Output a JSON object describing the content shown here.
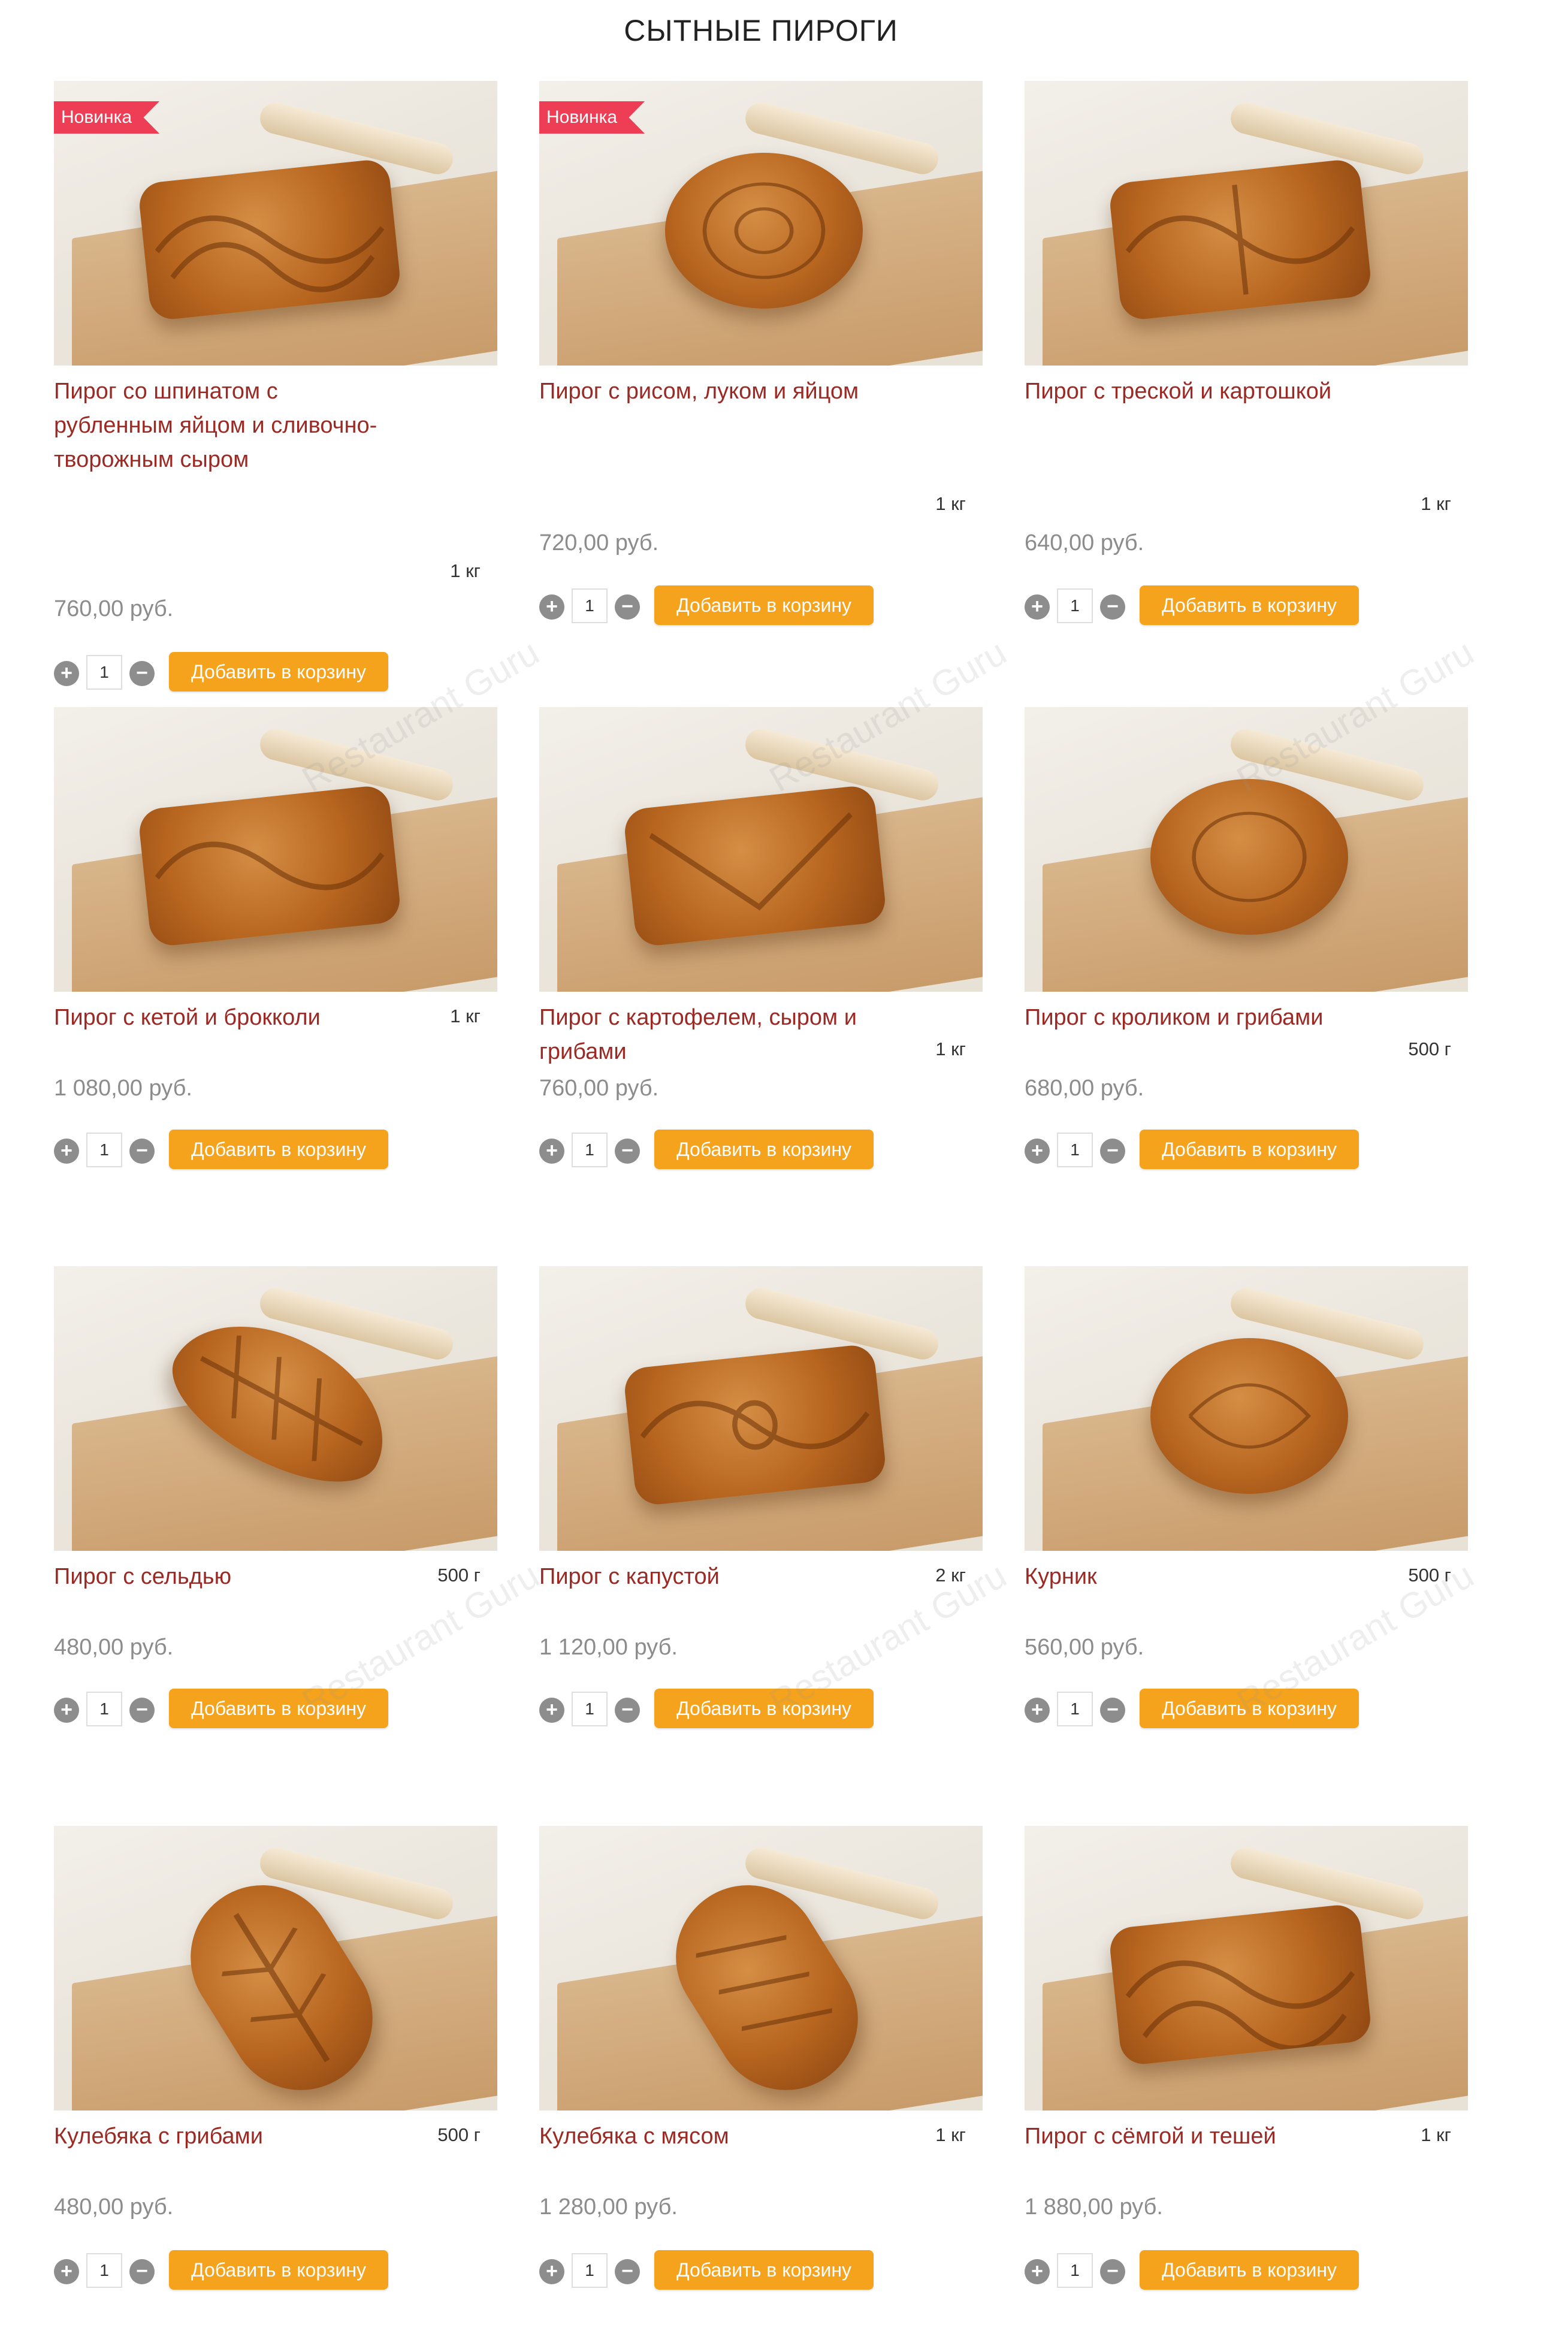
{
  "page": {
    "title": "СЫТНЫЕ ПИРОГИ"
  },
  "accent": {
    "name_color": "#9b2a24",
    "button_color": "#f5a21c",
    "badge_color": "#ee3e55",
    "price_color": "#8c8c8c"
  },
  "watermark": "Restaurant Guru",
  "products": [
    {
      "name": "Пирог со шпинатом с рубленным яйцом и сливочно-творожным сыром",
      "weight": "1 кг",
      "price": "760,00 руб.",
      "badge": "Новинка",
      "qty": "1",
      "add_label": "Добавить в корзину",
      "photo_icon": "pie-photo"
    },
    {
      "name": "Пирог с рисом, луком и яйцом",
      "weight": "1 кг",
      "price": "720,00 руб.",
      "badge": "Новинка",
      "qty": "1",
      "add_label": "Добавить в корзину",
      "photo_icon": "pie-photo"
    },
    {
      "name": "Пирог с треской и картошкой",
      "weight": "1 кг",
      "price": "640,00 руб.",
      "qty": "1",
      "add_label": "Добавить в корзину",
      "photo_icon": "pie-photo"
    },
    {
      "name": "Пирог с кетой и брокколи",
      "weight": "1 кг",
      "price": "1 080,00 руб.",
      "qty": "1",
      "add_label": "Добавить в корзину",
      "photo_icon": "pie-photo"
    },
    {
      "name": "Пирог с картофелем, сыром и грибами",
      "weight": "1 кг",
      "price": "760,00 руб.",
      "qty": "1",
      "add_label": "Добавить в корзину",
      "photo_icon": "pie-photo"
    },
    {
      "name": "Пирог с кроликом и грибами",
      "weight": "500 г",
      "price": "680,00 руб.",
      "qty": "1",
      "add_label": "Добавить в корзину",
      "photo_icon": "pie-photo"
    },
    {
      "name": "Пирог с сельдью",
      "weight": "500 г",
      "price": "480,00 руб.",
      "qty": "1",
      "add_label": "Добавить в корзину",
      "photo_icon": "pie-photo"
    },
    {
      "name": "Пирог с капустой",
      "weight": "2 кг",
      "price": "1 120,00 руб.",
      "qty": "1",
      "add_label": "Добавить в корзину",
      "photo_icon": "pie-photo"
    },
    {
      "name": "Курник",
      "weight": "500 г",
      "price": "560,00 руб.",
      "qty": "1",
      "add_label": "Добавить в корзину",
      "photo_icon": "pie-photo"
    },
    {
      "name": "Кулебяка с грибами",
      "weight": "500 г",
      "price": "480,00 руб.",
      "qty": "1",
      "add_label": "Добавить в корзину",
      "photo_icon": "pie-photo"
    },
    {
      "name": "Кулебяка с мясом",
      "weight": "1 кг",
      "price": "1 280,00 руб.",
      "qty": "1",
      "add_label": "Добавить в корзину",
      "photo_icon": "pie-photo"
    },
    {
      "name": "Пирог с сёмгой и тешей",
      "weight": "1 кг",
      "price": "1 880,00 руб.",
      "qty": "1",
      "add_label": "Добавить в корзину",
      "photo_icon": "pie-photo"
    }
  ]
}
